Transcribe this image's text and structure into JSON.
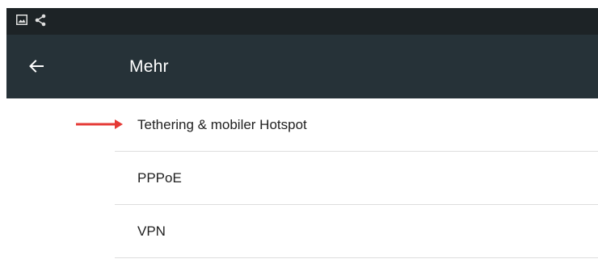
{
  "status_bar": {
    "icons": [
      "image-icon",
      "share-icon"
    ]
  },
  "app_bar": {
    "back_icon": "arrow-left-icon",
    "title": "Mehr"
  },
  "list": {
    "items": [
      {
        "label": "Tethering & mobiler Hotspot"
      },
      {
        "label": "PPPoE"
      },
      {
        "label": "VPN"
      }
    ]
  },
  "annotation": {
    "arrow_color": "#e53935",
    "points_to": "Tethering & mobiler Hotspot"
  },
  "colors": {
    "status_bar_bg": "#1d2326",
    "app_bar_bg": "#263238",
    "title_text": "#ffffff",
    "item_text": "#212121",
    "divider": "#dedede"
  }
}
